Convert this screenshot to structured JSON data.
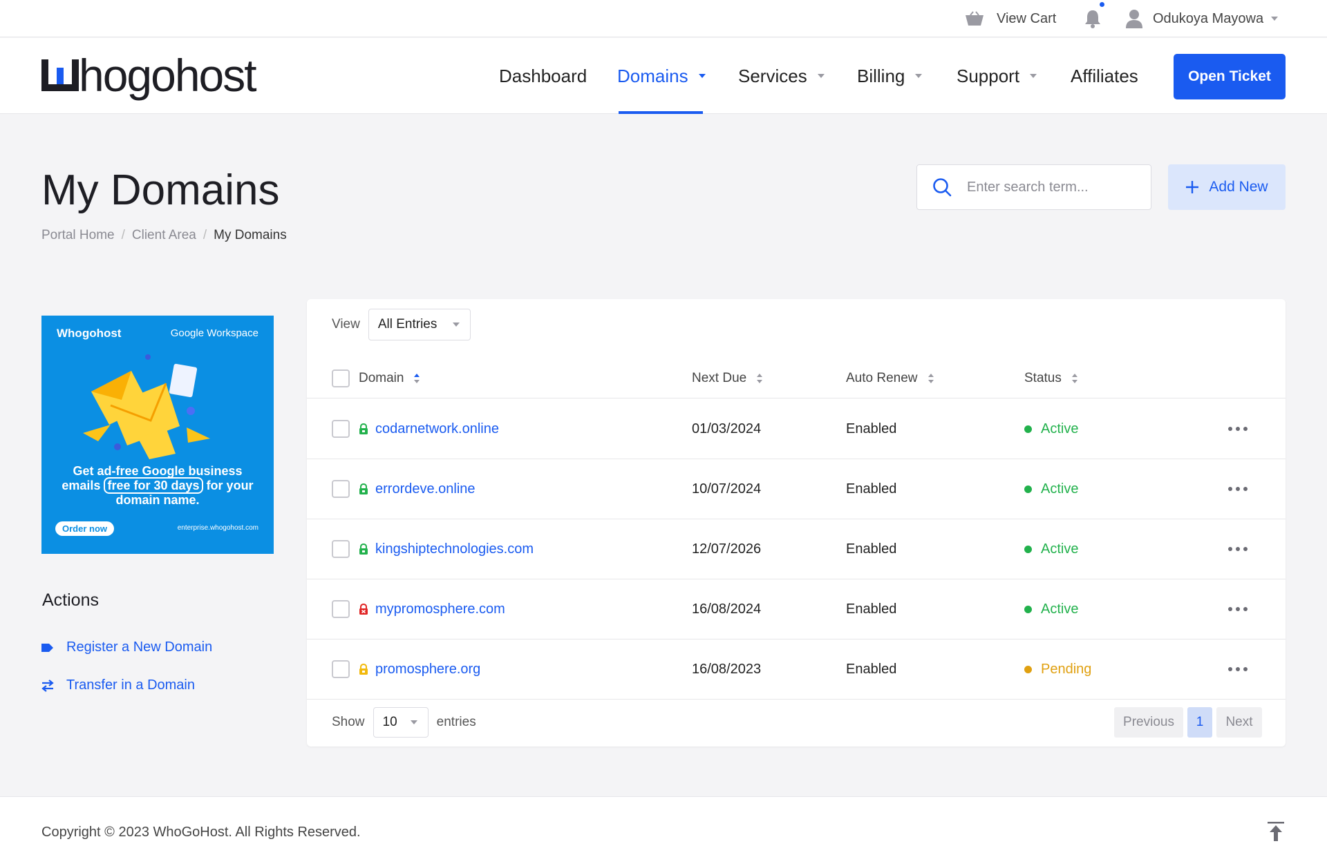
{
  "topbar": {
    "cart_label": "View Cart",
    "user_name": "Odukoya Mayowa"
  },
  "brand": {
    "logo_text": "hogohost"
  },
  "nav": {
    "dashboard": "Dashboard",
    "domains": "Domains",
    "services": "Services",
    "billing": "Billing",
    "support": "Support",
    "affiliates": "Affiliates",
    "open_ticket": "Open Ticket"
  },
  "page": {
    "title": "My Domains",
    "breadcrumb": [
      "Portal Home",
      "Client Area",
      "My Domains"
    ],
    "search_placeholder": "Enter search term...",
    "add_new": "Add New"
  },
  "promo": {
    "brand": "Whogohost",
    "partner": "Google Workspace",
    "headline_1": "Get ad-free Google business",
    "headline_2a": "emails",
    "headline_2b": "free for 30 days",
    "headline_2c": "for your",
    "headline_3": "domain name.",
    "order": "Order now",
    "url": "enterprise.whogohost.com"
  },
  "sidebar": {
    "actions_title": "Actions",
    "register": "Register a New Domain",
    "transfer": "Transfer in a Domain"
  },
  "table": {
    "view_label": "View",
    "view_value": "All Entries",
    "headers": {
      "domain": "Domain",
      "next_due": "Next Due",
      "auto_renew": "Auto Renew",
      "status": "Status"
    },
    "rows": [
      {
        "domain": "codarnetwork.online",
        "next_due": "01/03/2024",
        "auto_renew": "Enabled",
        "status": "Active",
        "lock": "green"
      },
      {
        "domain": "errordeve.online",
        "next_due": "10/07/2024",
        "auto_renew": "Enabled",
        "status": "Active",
        "lock": "green"
      },
      {
        "domain": "kingshiptechnologies.com",
        "next_due": "12/07/2026",
        "auto_renew": "Enabled",
        "status": "Active",
        "lock": "green"
      },
      {
        "domain": "mypromosphere.com",
        "next_due": "16/08/2024",
        "auto_renew": "Enabled",
        "status": "Active",
        "lock": "red"
      },
      {
        "domain": "promosphere.org",
        "next_due": "16/08/2023",
        "auto_renew": "Enabled",
        "status": "Pending",
        "lock": "yellow"
      }
    ],
    "show_label": "Show",
    "show_value": "10",
    "entries_label": "entries",
    "pager": {
      "previous": "Previous",
      "current": "1",
      "next": "Next"
    }
  },
  "footer": {
    "copyright": "Copyright © 2023 WhoGoHost. All Rights Reserved."
  },
  "colors": {
    "accent": "#1a5bf0",
    "active": "#22b14c",
    "pending": "#e0a010",
    "lock_red": "#e02424",
    "lock_yellow": "#f2b90c"
  }
}
